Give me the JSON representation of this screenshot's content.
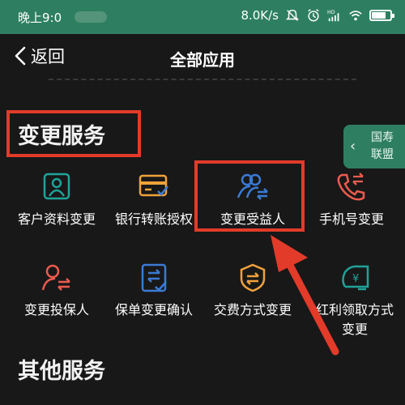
{
  "status_bar": {
    "time": "晚上9:0",
    "speed": "8.0K/s",
    "icons": [
      "mute-icon",
      "alarm-icon",
      "hd-signal-icon",
      "wifi-icon",
      "battery-icon"
    ]
  },
  "nav": {
    "back_label": "返回",
    "title": "全部应用"
  },
  "side_tab": {
    "line1": "国寿",
    "line2": "联盟"
  },
  "sections": {
    "change_services": "变更服务",
    "other_services": "其他服务"
  },
  "items": [
    {
      "label": "客户资料变更",
      "icon": "customer-profile-icon"
    },
    {
      "label": "银行转账授权",
      "icon": "bank-card-icon"
    },
    {
      "label": "变更受益人",
      "icon": "change-beneficiary-icon"
    },
    {
      "label": "手机号变更",
      "icon": "phone-change-icon"
    },
    {
      "label": "变更投保人",
      "icon": "change-policyholder-icon"
    },
    {
      "label": "保单变更确认",
      "icon": "policy-confirm-icon"
    },
    {
      "label": "交费方式变更",
      "icon": "payment-method-icon"
    },
    {
      "label": "红利领取方式",
      "icon": "dividend-icon"
    },
    {
      "label": "变更",
      "icon": ""
    }
  ],
  "colors": {
    "status_bar": "#2e7f62",
    "background": "#181818",
    "highlight": "#e23b2a",
    "icon_teal": "#1fa39a",
    "icon_orange": "#f0a23a",
    "icon_blue": "#3a7bd5",
    "icon_red": "#ec5b4f"
  }
}
